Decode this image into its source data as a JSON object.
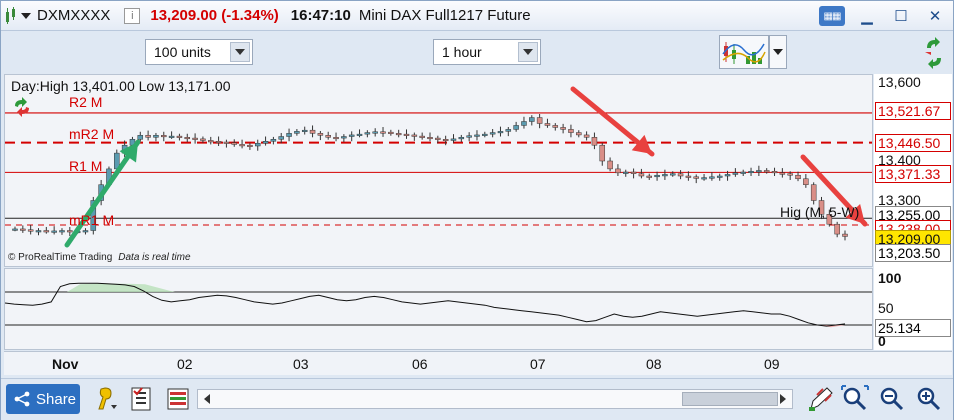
{
  "titlebar": {
    "symbol": "DXMXXXX",
    "info_icon_text": "i",
    "price": "13,209.00 (-1.34%)",
    "time": "16:47:10",
    "instrument": "Mini DAX Full1217 Future"
  },
  "toolbar": {
    "units": "100 units",
    "timeframe": "1 hour"
  },
  "chart": {
    "day_info": "Day:High 13,401.00 Low 13,171.00",
    "credit": "© ProRealTime Trading",
    "realtime": "Data is real time",
    "pivot_labels": {
      "r2": "R2 M",
      "mr2": "mR2 M",
      "r1": "R1 M",
      "mr1": "mR1 M"
    },
    "hig_label": "Hig (M, 5-W)",
    "price_axis": {
      "ticks": [
        "13,600",
        "13,400",
        "13,300"
      ],
      "boxes": {
        "r2": "13,521.67",
        "mr2": "13,446.50",
        "r1": "13,371.33",
        "hig": "13,255.00",
        "mr1": "13,238.00",
        "last": "13,209.00",
        "low": "13,203.50"
      }
    },
    "indicator_axis": {
      "ticks": [
        "100",
        "50",
        "0"
      ],
      "value": "25.134"
    },
    "date_labels": [
      "Nov",
      "02",
      "03",
      "06",
      "07",
      "08",
      "09"
    ]
  },
  "bottombar": {
    "share": "Share"
  },
  "colors": {
    "pivot": "#d40000",
    "up": "#5a9bb0",
    "down": "#d98e87",
    "arrow_green": "#2faa6b",
    "arrow_red": "#e8413f",
    "accent": "#2c6fc1"
  },
  "icons": [
    "grid-icon",
    "dropdown-arrow-icon",
    "info-icon",
    "keyboard-icon",
    "minimize-icon",
    "maximize-icon",
    "close-icon",
    "indicators-icon",
    "sync-icon",
    "refresh-icon",
    "share-icon",
    "bell-icon",
    "orders-icon",
    "positions-icon",
    "drawing-icon",
    "zoom-fit-icon",
    "zoom-out-icon",
    "zoom-in-icon"
  ]
}
